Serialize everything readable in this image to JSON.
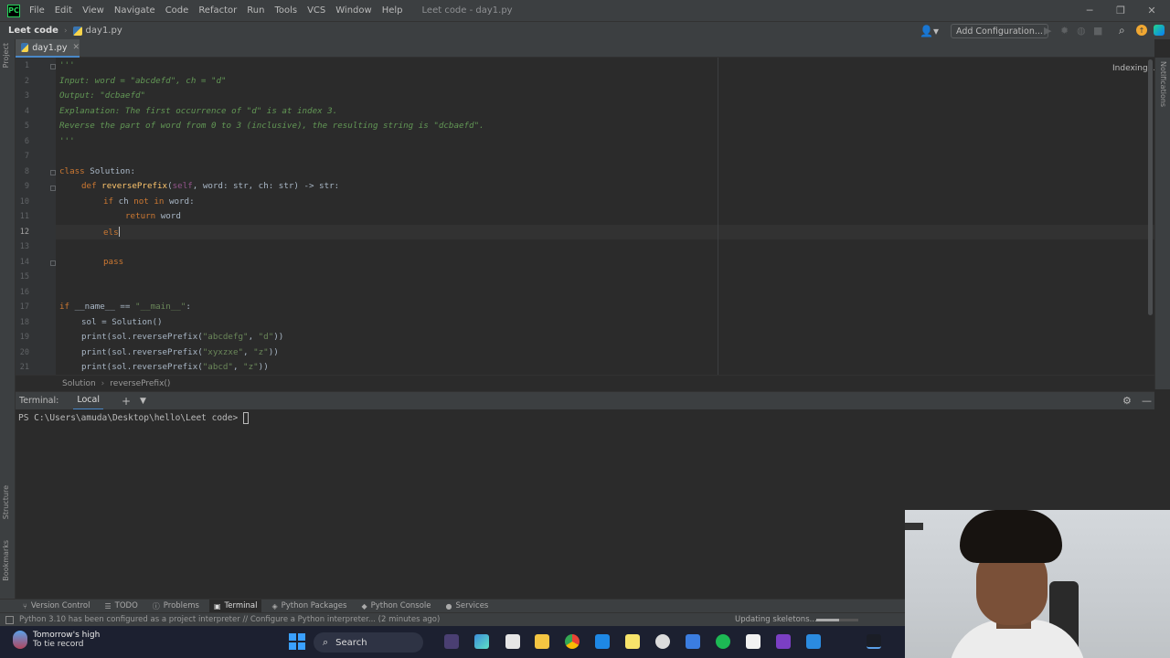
{
  "menubar": {
    "logo_text": "PC",
    "items": [
      "File",
      "Edit",
      "View",
      "Navigate",
      "Code",
      "Refactor",
      "Run",
      "Tools",
      "VCS",
      "Window",
      "Help"
    ],
    "window_title": "Leet code - day1.py"
  },
  "navbar": {
    "project": "Leet code",
    "file": "day1.py",
    "add_configuration": "Add Configuration..."
  },
  "tabs": [
    {
      "label": "day1.py"
    }
  ],
  "editor": {
    "indexing": "Indexing...",
    "line_numbers": [
      "1",
      "2",
      "3",
      "4",
      "5",
      "6",
      "7",
      "8",
      "9",
      "10",
      "11",
      "12",
      "13",
      "14",
      "15",
      "16",
      "17",
      "18",
      "19",
      "20",
      "21"
    ],
    "current_line": 12,
    "code": {
      "l1": "'''",
      "l2": "Input: word = \"abcdefd\", ch = \"d\"",
      "l3": "Output: \"dcbaefd\"",
      "l4": "Explanation: The first occurrence of \"d\" is at index 3.",
      "l5": "Reverse the part of word from 0 to 3 (inclusive), the resulting string is \"dcbaefd\".",
      "l6": "'''",
      "l8_kw": "class",
      "l8_name": " Solution:",
      "l9_kw": "def",
      "l9_fn": "reversePrefix",
      "l9_open": "(",
      "l9_self": "self",
      "l9_rest": ", word: str, ch: str) -> str:",
      "l10_kw1": "if",
      "l10_mid": " ch ",
      "l10_kw2": "not in",
      "l10_end": " word:",
      "l11_kw": "return",
      "l11_end": " word",
      "l12_kw": "els",
      "l14_kw": "pass",
      "l17_kw": "if",
      "l17_mid": " __name__ == ",
      "l17_str": "\"__main__\"",
      "l17_end": ":",
      "l18": "sol = Solution()",
      "l19_pre": "print(sol.reversePrefix(",
      "l19_s1": "\"abcdefg\"",
      "l19_s2": "\"d\"",
      "l19_end": "))",
      "l20_pre": "print(sol.reversePrefix(",
      "l20_s1": "\"xyxzxe\"",
      "l20_s2": "\"z\"",
      "l20_end": "))",
      "l21_pre": "print(sol.reversePrefix(",
      "l21_s1": "\"abcd\"",
      "l21_s2": "\"z\"",
      "l21_end": "))",
      "comma": ", "
    },
    "breadcrumb": [
      "Solution",
      "reversePrefix()"
    ]
  },
  "left_strip": {
    "project": "Project",
    "structure": "Structure",
    "bookmarks": "Bookmarks"
  },
  "right_strip": {
    "notifications": "Notifications"
  },
  "terminal": {
    "title": "Terminal:",
    "tab": "Local",
    "prompt": "PS C:\\Users\\amuda\\Desktop\\hello\\Leet code>"
  },
  "toolwindows": [
    "Version Control",
    "TODO",
    "Problems",
    "Terminal",
    "Python Packages",
    "Python Console",
    "Services"
  ],
  "active_toolwindow": "Terminal",
  "statusbar": {
    "message": "Python 3.10 has been configured as a project interpreter // Configure a Python interpreter... (2 minutes ago)",
    "background_task": "Updating skeletons...",
    "progress_fraction": 0.55
  },
  "taskbar": {
    "weather_title": "Tomorrow's high",
    "weather_sub": "To tie record",
    "search_label": "Search"
  },
  "colors": {
    "keyword": "#cc7832",
    "function": "#ffc66d",
    "string": "#6a8759",
    "docstring": "#629755",
    "accent": "#4a88c7"
  }
}
